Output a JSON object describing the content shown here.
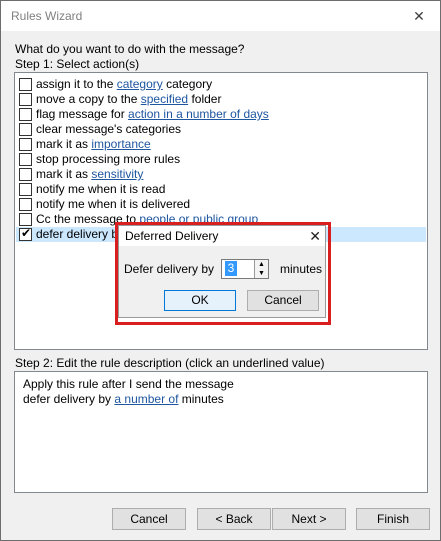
{
  "window": {
    "title": "Rules Wizard"
  },
  "question": "What do you want to do with the message?",
  "step1": "Step 1: Select action(s)",
  "actions": [
    {
      "pre": "assign it to the ",
      "link": "category",
      "post": " category",
      "checked": false
    },
    {
      "pre": "move a copy to the ",
      "link": "specified",
      "post": " folder",
      "checked": false
    },
    {
      "pre": "flag message for ",
      "link": "action in a number of days",
      "post": "",
      "checked": false
    },
    {
      "pre": "clear message's categories",
      "link": "",
      "post": "",
      "checked": false
    },
    {
      "pre": "mark it as ",
      "link": "importance",
      "post": "",
      "checked": false
    },
    {
      "pre": "stop processing more rules",
      "link": "",
      "post": "",
      "checked": false
    },
    {
      "pre": "mark it as ",
      "link": "sensitivity",
      "post": "",
      "checked": false
    },
    {
      "pre": "notify me when it is read",
      "link": "",
      "post": "",
      "checked": false
    },
    {
      "pre": "notify me when it is delivered",
      "link": "",
      "post": "",
      "checked": false
    },
    {
      "pre": "Cc the message to ",
      "link": "people or public group",
      "post": "",
      "checked": false
    },
    {
      "pre": "defer delivery by",
      "link": "",
      "post": "",
      "checked": true
    }
  ],
  "step2": "Step 2: Edit the rule description (click an underlined value)",
  "description": {
    "line1": "Apply this rule after I send the message",
    "line2_pre": "defer delivery by ",
    "line2_link": "a number of",
    "line2_post": " minutes"
  },
  "buttons": {
    "cancel": "Cancel",
    "back": "< Back",
    "next": "Next >",
    "finish": "Finish"
  },
  "dialog": {
    "title": "Deferred Delivery",
    "label": "Defer delivery by",
    "value": "3",
    "unit": "minutes",
    "ok": "OK",
    "cancel": "Cancel"
  },
  "icons": {
    "close": "close-icon",
    "check": "checkmark-icon",
    "spin": "spinner-arrows-icon"
  },
  "colors": {
    "link": "#1e56a0",
    "selection": "#cce8ff",
    "highlight_box": "#d81e1e"
  }
}
